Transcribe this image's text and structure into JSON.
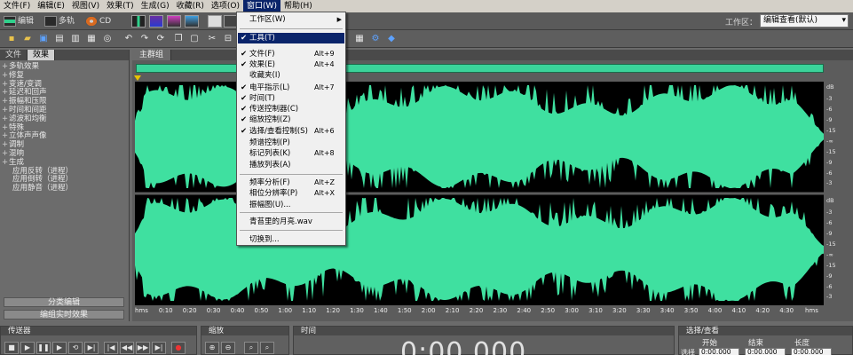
{
  "menubar": {
    "items": [
      "文件(F)",
      "编辑(E)",
      "视图(V)",
      "效果(T)",
      "生成(G)",
      "收藏(R)",
      "选项(O)",
      "窗口(W)",
      "帮助(H)"
    ],
    "active_index": 7
  },
  "modebar": {
    "edit_label": "编辑",
    "multitrack_label": "多轨",
    "cd_label": "CD",
    "workspace_label": "工作区：",
    "workspace_value": "编辑查看(默认)"
  },
  "left_panel": {
    "tabs": [
      "文件",
      "效果"
    ],
    "tree": [
      {
        "label": "多轨效果",
        "expandable": true
      },
      {
        "label": "修复",
        "expandable": true
      },
      {
        "label": "变速/变调",
        "expandable": true
      },
      {
        "label": "延迟和回声",
        "expandable": true
      },
      {
        "label": "振幅和压限",
        "expandable": true
      },
      {
        "label": "时间和间距",
        "expandable": true
      },
      {
        "label": "滤波和均衡",
        "expandable": true
      },
      {
        "label": "特殊",
        "expandable": true
      },
      {
        "label": "立体声声像",
        "expandable": true
      },
      {
        "label": "调制",
        "expandable": true
      },
      {
        "label": "混响",
        "expandable": true
      },
      {
        "label": "生成",
        "expandable": true
      },
      {
        "label": "应用反转（进程）",
        "expandable": false
      },
      {
        "label": "应用倒转（进程）",
        "expandable": false
      },
      {
        "label": "应用静音（进程）",
        "expandable": false
      }
    ],
    "group_button": "分类编辑",
    "realtime_button": "编组实时效果"
  },
  "main_panel": {
    "tab_label": "主群组",
    "db_labels_top": [
      "dB",
      "-3",
      "-6",
      "-9",
      "-15",
      "-∞",
      "-15",
      "-9",
      "-6",
      "-3"
    ],
    "db_labels_bottom": [
      "dB",
      "-3",
      "-6",
      "-9",
      "-15",
      "-∞",
      "-15",
      "-9",
      "-6",
      "-3"
    ],
    "time_ticks": [
      "hms",
      "0:10",
      "0:20",
      "0:30",
      "0:40",
      "0:50",
      "1:00",
      "1:10",
      "1:20",
      "1:30",
      "1:40",
      "1:50",
      "2:00",
      "2:10",
      "2:20",
      "2:30",
      "2:40",
      "2:50",
      "3:00",
      "3:10",
      "3:20",
      "3:30",
      "3:40",
      "3:50",
      "4:00",
      "4:10",
      "4:20",
      "4:30",
      "hms"
    ]
  },
  "dropdown": {
    "items": [
      {
        "label": "工作区(W)",
        "check": false,
        "shortcut": "",
        "submenu": true
      },
      {
        "label": "工具(T)",
        "check": true,
        "shortcut": "",
        "highlighted": true
      },
      {
        "label": "文件(F)",
        "check": true,
        "shortcut": "Alt+9"
      },
      {
        "label": "效果(E)",
        "check": true,
        "shortcut": "Alt+4"
      },
      {
        "label": "收藏夹(I)",
        "check": false,
        "shortcut": ""
      },
      {
        "label": "电平指示(L)",
        "check": true,
        "shortcut": "Alt+7"
      },
      {
        "label": "时间(T)",
        "check": true,
        "shortcut": ""
      },
      {
        "label": "传送控制器(C)",
        "check": true,
        "shortcut": ""
      },
      {
        "label": "缩放控制(Z)",
        "check": true,
        "shortcut": ""
      },
      {
        "label": "选择/查看控制(S)",
        "check": true,
        "shortcut": "Alt+6"
      },
      {
        "label": "频谱控制(P)",
        "check": false,
        "shortcut": ""
      },
      {
        "label": "标记列表(K)",
        "check": false,
        "shortcut": "Alt+8"
      },
      {
        "label": "播放列表(A)",
        "check": false,
        "shortcut": ""
      },
      {
        "label": "频率分析(F)",
        "check": false,
        "shortcut": "Alt+Z"
      },
      {
        "label": "相位分辨率(P)",
        "check": false,
        "shortcut": "Alt+X"
      },
      {
        "label": "振幅图(U)...",
        "check": false,
        "shortcut": ""
      },
      {
        "label": "青苔里的月亮.wav",
        "check": false,
        "shortcut": ""
      },
      {
        "label": "切换到...",
        "check": false,
        "shortcut": ""
      }
    ]
  },
  "transport": {
    "title": "传送器"
  },
  "zoom": {
    "title": "缩放"
  },
  "time_panel": {
    "title": "时间",
    "display": "0:00.000"
  },
  "selection_panel": {
    "title": "选择/查看",
    "headers": [
      "开始",
      "结束",
      "长度"
    ],
    "row_label": "选择",
    "values": [
      "0:00.000",
      "0:00.000",
      "0:00.000"
    ]
  },
  "colors": {
    "waveform": "#3fe0a0",
    "menu_highlight": "#0a246a"
  }
}
